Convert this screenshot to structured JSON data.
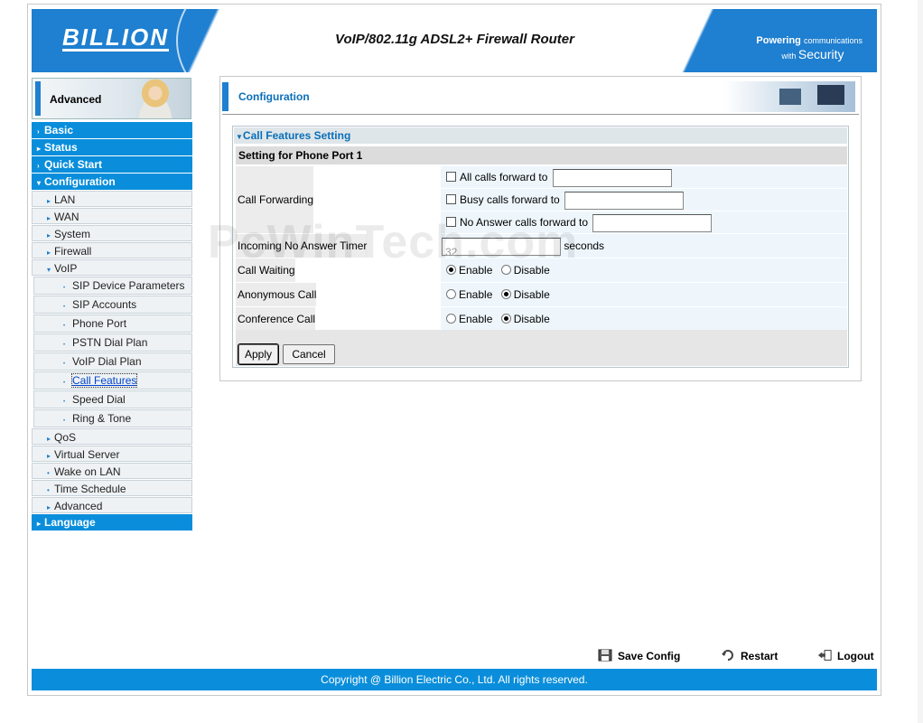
{
  "header": {
    "logo": "BILLION",
    "title": "VoIP/802.11g ADSL2+ Firewall Router",
    "tagline_powering": "Powering",
    "tagline_communications": "communications",
    "tagline_with": "with",
    "tagline_security": "Security"
  },
  "sidebar": {
    "section_label": "Advanced",
    "menu": [
      {
        "label": "Basic",
        "level": "top",
        "marker": "›"
      },
      {
        "label": "Status",
        "level": "top",
        "marker": "▸"
      },
      {
        "label": "Quick Start",
        "level": "top",
        "marker": "›"
      },
      {
        "label": "Configuration",
        "level": "top",
        "marker": "▾"
      },
      {
        "label": "LAN",
        "level": "sub",
        "marker": "▸"
      },
      {
        "label": "WAN",
        "level": "sub",
        "marker": "▸"
      },
      {
        "label": "System",
        "level": "sub",
        "marker": "▸"
      },
      {
        "label": "Firewall",
        "level": "sub",
        "marker": "▸"
      },
      {
        "label": "VoIP",
        "level": "sub",
        "marker": "▾"
      },
      {
        "label": "SIP Device Parameters",
        "level": "sub2",
        "marker": "•"
      },
      {
        "label": "SIP Accounts",
        "level": "sub2",
        "marker": "•"
      },
      {
        "label": "Phone Port",
        "level": "sub2",
        "marker": "•"
      },
      {
        "label": "PSTN Dial Plan",
        "level": "sub2",
        "marker": "•"
      },
      {
        "label": "VoIP Dial Plan",
        "level": "sub2",
        "marker": "•"
      },
      {
        "label": "Call Features",
        "level": "sub2",
        "marker": "•",
        "active": true
      },
      {
        "label": "Speed Dial",
        "level": "sub2",
        "marker": "•"
      },
      {
        "label": "Ring & Tone",
        "level": "sub2",
        "marker": "•"
      },
      {
        "label": "QoS",
        "level": "sub",
        "marker": "▸"
      },
      {
        "label": "Virtual Server",
        "level": "sub",
        "marker": "▸"
      },
      {
        "label": "Wake on LAN",
        "level": "sub",
        "marker": "•"
      },
      {
        "label": "Time Schedule",
        "level": "sub",
        "marker": "•"
      },
      {
        "label": "Advanced",
        "level": "sub",
        "marker": "▸"
      },
      {
        "label": "Language",
        "level": "top",
        "marker": "▸"
      }
    ]
  },
  "main": {
    "panel_title": "Configuration",
    "section_title": "Call Features Setting",
    "sub_title": "Setting for Phone Port 1",
    "call_forwarding": {
      "label": "Call Forwarding",
      "all_calls_label": "All calls forward to",
      "all_calls_value": "",
      "busy_calls_label": "Busy calls forward to",
      "busy_calls_value": "",
      "no_answer_label": "No Answer calls forward to",
      "no_answer_value": ""
    },
    "no_answer_timer": {
      "label": "Incoming No Answer Timer",
      "value": "32",
      "unit": "seconds"
    },
    "call_waiting": {
      "label": "Call Waiting",
      "enable": "Enable",
      "disable": "Disable",
      "selected": "Enable"
    },
    "anonymous_call": {
      "label": "Anonymous Call",
      "enable": "Enable",
      "disable": "Disable",
      "selected": "Disable"
    },
    "conference_call": {
      "label": "Conference Call",
      "enable": "Enable",
      "disable": "Disable",
      "selected": "Disable"
    },
    "apply_label": "Apply",
    "cancel_label": "Cancel"
  },
  "footer": {
    "save_config": "Save Config",
    "restart": "Restart",
    "logout": "Logout",
    "copyright": "Copyright @ Billion Electric Co., Ltd. All rights reserved."
  },
  "watermark": "PcWinTech.com",
  "colors": {
    "brand_blue": "#1f7fd0",
    "menu_blue": "#0a8edb",
    "title_blue": "#0a6fb8"
  }
}
